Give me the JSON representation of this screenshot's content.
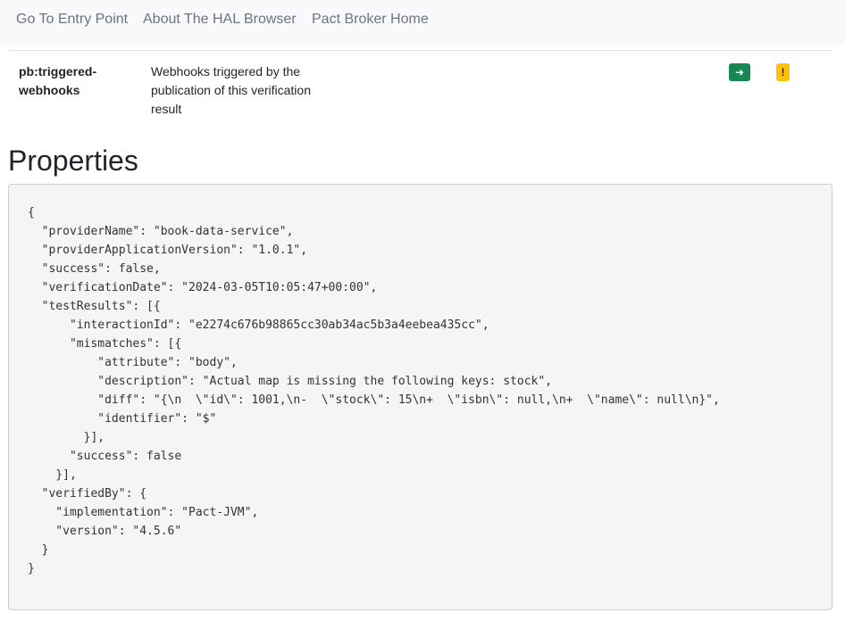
{
  "nav": {
    "items": [
      {
        "label": "Go To Entry Point"
      },
      {
        "label": "About The HAL Browser"
      },
      {
        "label": "Pact Broker Home"
      }
    ]
  },
  "links": {
    "rows": [
      {
        "rel": "pb:triggered-webhooks",
        "title": "Webhooks triggered by the publication of this verification result",
        "follow_icon": "arrow-right-icon",
        "follow_glyph": "➜",
        "non_get_icon": "exclamation-icon",
        "non_get_glyph": "!"
      }
    ],
    "colors": {
      "follow": "#198754",
      "non_get": "#ffc107"
    }
  },
  "properties": {
    "heading": "Properties",
    "json_text": "{\n  \"providerName\": \"book-data-service\",\n  \"providerApplicationVersion\": \"1.0.1\",\n  \"success\": false,\n  \"verificationDate\": \"2024-03-05T10:05:47+00:00\",\n  \"testResults\": [{\n      \"interactionId\": \"e2274c676b98865cc30ab34ac5b3a4eebea435cc\",\n      \"mismatches\": [{\n          \"attribute\": \"body\",\n          \"description\": \"Actual map is missing the following keys: stock\",\n          \"diff\": \"{\\n  \\\"id\\\": 1001,\\n-  \\\"stock\\\": 15\\n+  \\\"isbn\\\": null,\\n+  \\\"name\\\": null\\n}\",\n          \"identifier\": \"$\"\n        }],\n      \"success\": false\n    }],\n  \"verifiedBy\": {\n    \"implementation\": \"Pact-JVM\",\n    \"version\": \"4.5.6\"\n  }\n}"
  }
}
